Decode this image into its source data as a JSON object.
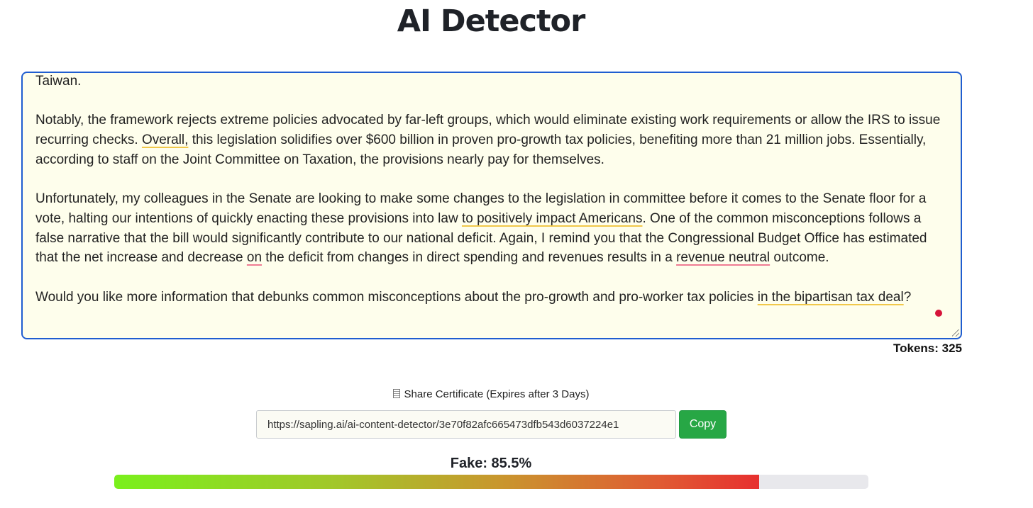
{
  "title": "AI Detector",
  "editor": {
    "paragraphs": [
      [
        {
          "text": "Taiwan."
        }
      ],
      [
        {
          "text": "Notably, the framework rejects extreme policies advocated by far-left groups, which would eliminate existing work requirements or allow the IRS to issue recurring checks. "
        },
        {
          "text": "Overall,",
          "hl": "yellow"
        },
        {
          "text": " this legislation solidifies over $600 billion in proven pro-growth tax policies, benefiting more than 21 million jobs. Essentially, according to staff on the Joint Committee on Taxation, the provisions nearly pay for themselves."
        }
      ],
      [
        {
          "text": "Unfortunately, my colleagues in the Senate are looking to make some changes to the legislation in committee before it comes to the Senate floor for a vote, halting our intentions of quickly enacting these provisions into law "
        },
        {
          "text": "to positively impact Americans",
          "hl": "yellow"
        },
        {
          "text": ". One of the common misconceptions follows a false narrative that the bill would significantly contribute to our national deficit. Again, I remind you that the Congressional Budget Office has estimated that the net increase and decrease "
        },
        {
          "text": "on",
          "hl": "red"
        },
        {
          "text": " the deficit from changes in direct spending and revenues results in a "
        },
        {
          "text": "revenue neutral",
          "hl": "red"
        },
        {
          "text": " outcome."
        }
      ],
      [
        {
          "text": "Would you like more information that debunks common misconceptions about the pro-growth and pro-worker tax policies "
        },
        {
          "text": "in the bipartisan tax deal",
          "hl": "yellow"
        },
        {
          "text": "?"
        }
      ]
    ]
  },
  "tokens": {
    "label": "Tokens:",
    "value": "325",
    "text": "Tokens: 325"
  },
  "share": {
    "icon": "document-icon",
    "label": "Share Certificate (Expires after 3 Days)",
    "url": "https://sapling.ai/ai-content-detector/3e70f82afc665473dfb543d6037224e1",
    "copy_label": "Copy"
  },
  "result": {
    "text": "Fake: 85.5%",
    "fake_percent": 85.5
  },
  "colors": {
    "accent_border": "#1f5dd0",
    "editor_background": "#fefeec",
    "highlight_yellow": "#f1c84a",
    "highlight_red": "#ef7c93",
    "copy_button": "#27a745",
    "progress_start": "#7af01c",
    "progress_end": "#e7302f"
  }
}
